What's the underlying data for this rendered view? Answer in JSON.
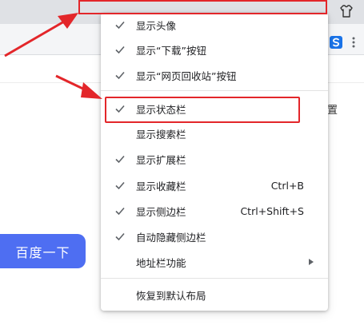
{
  "baidu": {
    "search_button_label": "百度一下"
  },
  "page": {
    "right_partial_char": "置"
  },
  "menu": {
    "items": [
      {
        "label": "显示头像",
        "checked": true,
        "shortcut": ""
      },
      {
        "label": "显示“下载”按钮",
        "checked": true,
        "shortcut": ""
      },
      {
        "label": "显示“网页回收站”按钮",
        "checked": true,
        "shortcut": ""
      },
      {
        "label": "显示状态栏",
        "checked": true,
        "shortcut": ""
      },
      {
        "label": "显示搜索栏",
        "checked": false,
        "shortcut": ""
      },
      {
        "label": "显示扩展栏",
        "checked": true,
        "shortcut": ""
      },
      {
        "label": "显示收藏栏",
        "checked": true,
        "shortcut": "Ctrl+B"
      },
      {
        "label": "显示侧边栏",
        "checked": true,
        "shortcut": "Ctrl+Shift+S"
      },
      {
        "label": "自动隐藏侧边栏",
        "checked": true,
        "shortcut": ""
      },
      {
        "label": "地址栏功能",
        "checked": false,
        "shortcut": "",
        "submenu": true
      },
      {
        "label": "恢复到默认布局",
        "checked": false,
        "shortcut": ""
      }
    ]
  },
  "colors": {
    "annotation_red": "#e3262a",
    "baidu_blue": "#4e6ef2"
  }
}
